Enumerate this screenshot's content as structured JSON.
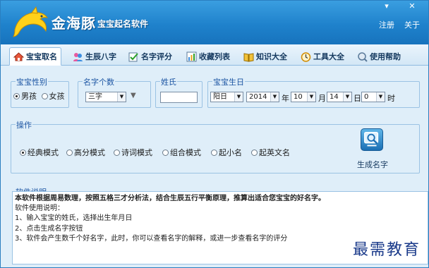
{
  "app": {
    "name": "金海豚",
    "subtitle": "宝宝起名软件",
    "register_label": "注册",
    "about_label": "关于",
    "minimize_glyph": "▾",
    "close_glyph": "✕"
  },
  "tabs": [
    {
      "label": "宝宝取名",
      "icon": "house-icon",
      "active": true
    },
    {
      "label": "生辰八字",
      "icon": "person-icon",
      "active": false
    },
    {
      "label": "名字评分",
      "icon": "check-icon",
      "active": false
    },
    {
      "label": "收藏列表",
      "icon": "chart-icon",
      "active": false
    },
    {
      "label": "知识大全",
      "icon": "book-icon",
      "active": false
    },
    {
      "label": "工具大全",
      "icon": "clock-icon",
      "active": false
    },
    {
      "label": "使用帮助",
      "icon": "help-icon",
      "active": false
    }
  ],
  "gender": {
    "label": "宝宝性别",
    "options": [
      "男孩",
      "女孩"
    ],
    "selected": "男孩"
  },
  "name_length": {
    "label": "名字个数",
    "value": "三字",
    "extra_glyph": "▼"
  },
  "surname": {
    "label": "姓氏",
    "value": ""
  },
  "birthday": {
    "label": "宝宝生日",
    "calendar": "阳日",
    "year": "2014",
    "year_unit": "年",
    "month": "10",
    "month_unit": "月",
    "day": "14",
    "day_unit": "日",
    "hour": "0",
    "hour_unit": "时"
  },
  "operations": {
    "label": "操作",
    "modes": [
      "经典模式",
      "高分模式",
      "诗词模式",
      "组合模式",
      "起小名",
      "起英文名"
    ],
    "selected": "经典模式",
    "generate_label": "生成名字"
  },
  "description": {
    "label": "软件说明",
    "headline": "本软件根据周易数理，按照五格三才分析法，结合生辰五行平衡原理，推算出适合您宝宝的好名字。",
    "lines": [
      "软件使用说明：",
      "1、输入宝宝的姓氏，选择出生年月日",
      "2、点击生成名字按钮",
      "3、软件会产生数千个好名字，此时，你可以查看名字的解释，或进一步查看名字的评分"
    ]
  },
  "watermark": "最需教育",
  "colors": {
    "accent": "#1f82cc",
    "group_label": "#1c55a3",
    "background": "#dfeef9"
  }
}
